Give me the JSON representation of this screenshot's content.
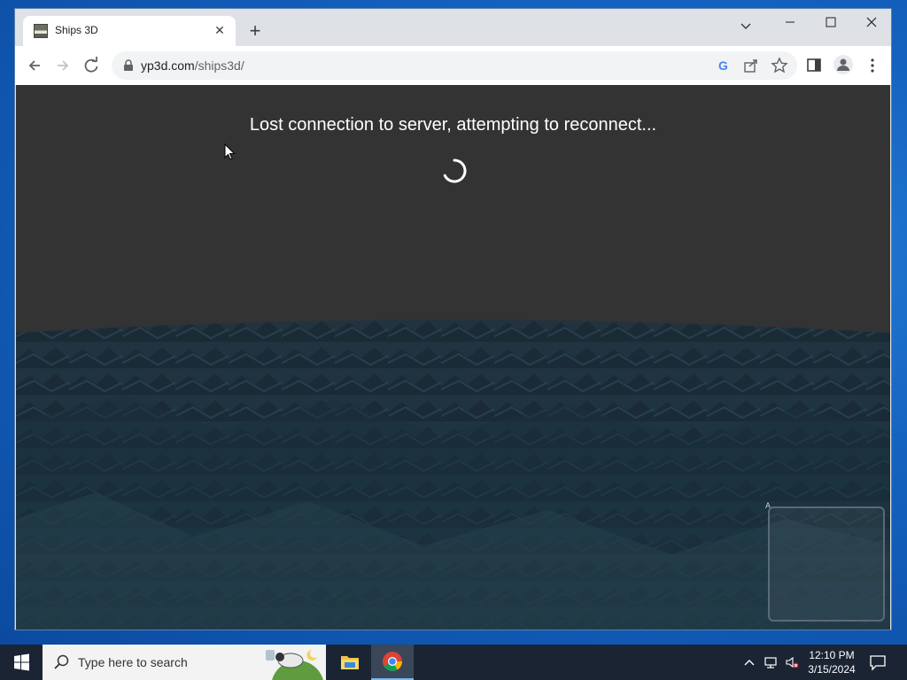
{
  "browser": {
    "tab_title": "Ships 3D",
    "url_host": "yp3d.com",
    "url_path": "/ships3d/"
  },
  "game": {
    "status_message": "Lost connection to server, attempting to reconnect...",
    "minimap_marker": "A"
  },
  "taskbar": {
    "search_placeholder": "Type here to search",
    "time": "12:10 PM",
    "date": "3/15/2024"
  },
  "colors": {
    "accent": "#76b9ed",
    "sky": "#333333",
    "sea": "#1f3a4a"
  },
  "icons": [
    "back-icon",
    "forward-icon",
    "reload-icon",
    "lock-icon",
    "google-icon",
    "share-icon",
    "star-icon",
    "side-panel-icon",
    "profile-icon",
    "menu-icon",
    "windows-start-icon",
    "search-icon",
    "file-explorer-icon",
    "chrome-icon",
    "chevron-up-icon",
    "network-icon",
    "volume-muted-icon",
    "notification-icon"
  ]
}
